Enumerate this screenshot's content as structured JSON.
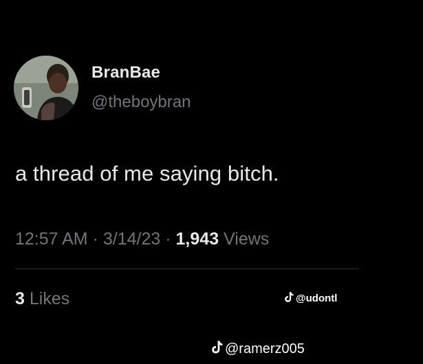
{
  "colors": {
    "background": "#000000",
    "primary_text": "#e7e9ea",
    "secondary_text": "#71767b",
    "divider": "#2f3336"
  },
  "author": {
    "display_name": "BranBae",
    "handle": "@theboybran",
    "avatar_icon": "profile-photo"
  },
  "tweet": {
    "text": "a thread of me saying bitch."
  },
  "meta": {
    "time": "12:57 AM",
    "separator": "·",
    "date": "3/14/23",
    "views_count": "1,943",
    "views_label": "Views"
  },
  "engagement": {
    "likes_count": "3",
    "likes_label": "Likes"
  },
  "watermarks": {
    "icon": "tiktok-icon",
    "small": "@udontl",
    "large": "@ramerz005"
  }
}
